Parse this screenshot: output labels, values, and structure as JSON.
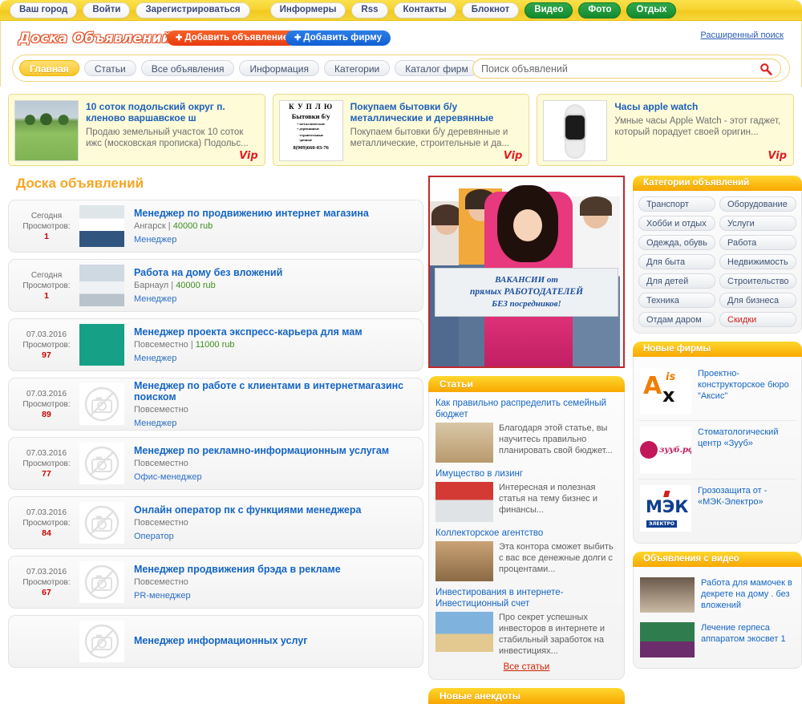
{
  "topbar": {
    "items": [
      {
        "label": "Ваш город",
        "style": "light"
      },
      {
        "label": "Войти",
        "style": "light"
      },
      {
        "label": "Зарегистрироваться",
        "style": "light"
      },
      {
        "label": "Информеры",
        "style": "light"
      },
      {
        "label": "Rss",
        "style": "light"
      },
      {
        "label": "Контакты",
        "style": "light"
      },
      {
        "label": "Блокнот",
        "style": "light"
      },
      {
        "label": "Видео",
        "style": "green"
      },
      {
        "label": "Фото",
        "style": "green"
      },
      {
        "label": "Отдых",
        "style": "green"
      }
    ]
  },
  "header": {
    "logo": "Доска Объявлений",
    "add_ad_button": "Добавить объявление",
    "add_firm_button": "Добавить фирму",
    "advanced_search": "Расширенный поиск",
    "plus": "✚",
    "search_placeholder": "Поиск объявлений",
    "search_value": "",
    "search_icon": "search-icon"
  },
  "tabs": [
    {
      "label": "Главная",
      "active": true
    },
    {
      "label": "Статьи",
      "active": false
    },
    {
      "label": "Все объявления",
      "active": false
    },
    {
      "label": "Информация",
      "active": false
    },
    {
      "label": "Категории",
      "active": false
    },
    {
      "label": "Каталог фирм",
      "active": false
    }
  ],
  "vip_cards": [
    {
      "title": "10 соток подольский округ п. кленово варшавское ш",
      "desc": "Продаю земельный участок 10 соток ижс (московская прописка) Подольс...",
      "badge": "Vip",
      "art": "land"
    },
    {
      "title": "Покупаем бытовки б/у металлические и деревянные",
      "desc": "Покупаем бытовки б/у деревянные и металлические, строительные и да...",
      "badge": "Vip",
      "art": "kuplyu",
      "art_text": {
        "line1": "К У П Л Ю",
        "line2": "Бытовки б/у",
        "line3": "• металлические\n• деревянные",
        "line4": "-строительные\n-дачные",
        "phone": "8(909)660-03-76"
      }
    },
    {
      "title": "Часы apple watch",
      "desc": "Умные часы Apple Watch - этот гаджет, который порадует своей оригин...",
      "badge": "Vip",
      "art": "watch"
    }
  ],
  "board": {
    "title": "Доска объявлений",
    "views_label": "Просмотров:",
    "listings": [
      {
        "date": "Сегодня",
        "views": "1",
        "title": "Менеджер по продвижению интернет магазина",
        "city": "Ангарск",
        "price": "40000 rub",
        "category": "Менеджер",
        "thumb": "photo-a"
      },
      {
        "date": "Сегодня",
        "views": "1",
        "title": "Работа на дому без вложений",
        "city": "Барнаул",
        "price": "40000 rub",
        "category": "Менеджер",
        "thumb": "photo-b"
      },
      {
        "date": "07.03.2016",
        "views": "97",
        "title": "Менеджер проекта экспресс-карьера для мам",
        "city": "Повсеместно",
        "price": "11000 rub",
        "category": "Менеджер",
        "thumb": "photo-c"
      },
      {
        "date": "07.03.2016",
        "views": "89",
        "title": "Менеджер по работе с клиентами в интернетмагазинс поиском",
        "city": "Повсеместно",
        "price": "",
        "category": "Менеджер",
        "thumb": "nophoto"
      },
      {
        "date": "07.03.2016",
        "views": "77",
        "title": "Менеджер по рекламно-информационным услугам",
        "city": "Повсеместно",
        "price": "",
        "category": "Офис-менеджер",
        "thumb": "nophoto"
      },
      {
        "date": "07.03.2016",
        "views": "84",
        "title": "Онлайн оператор пк с функциями менеджера",
        "city": "Повсеместно",
        "price": "",
        "category": "Оператор",
        "thumb": "nophoto"
      },
      {
        "date": "07.03.2016",
        "views": "67",
        "title": "Менеджер продвижения брэда в рекламе",
        "city": "Повсеместно",
        "price": "",
        "category": "PR-менеджер",
        "thumb": "nophoto"
      },
      {
        "date": "",
        "views": "",
        "title": "Менеджер информационных услуг",
        "city": "",
        "price": "",
        "category": "",
        "thumb": "nophoto"
      }
    ]
  },
  "banner": {
    "line1": "ВАКАНСИИ от",
    "line2": "прямых РАБОТОДАТЕЛЕЙ",
    "line3": "БЕЗ посредников!"
  },
  "articles": {
    "heading": "Статьи",
    "all_link": "Все статьи",
    "items": [
      {
        "title": "Как правильно распределить семейный бюджет",
        "desc": "Благодаря этой статье, вы научитесь правильно планировать свой бюджет...",
        "thumb": "th1"
      },
      {
        "title": "Имущество в лизинг",
        "desc": "Интересная и полезная статья на тему бизнес и финансы...",
        "thumb": "th2"
      },
      {
        "title": "Коллекторское агентство",
        "desc": "Эта контора сможет выбить с вас все денежные долги с процентами...",
        "thumb": "th3"
      },
      {
        "title": "Инвестирования в интернете- Инвестиционный счет",
        "desc": "Про секрет успешных инвесторов в интернете и стабильный заработок на инвестициях...",
        "thumb": "th4"
      }
    ]
  },
  "jokes": {
    "heading": "Новые анекдоты"
  },
  "categories": {
    "heading": "Категории объявлений",
    "items": [
      {
        "label": "Транспорт",
        "sale": false
      },
      {
        "label": "Оборудование",
        "sale": false
      },
      {
        "label": "Хобби и отдых",
        "sale": false
      },
      {
        "label": "Услуги",
        "sale": false
      },
      {
        "label": "Одежда, обувь",
        "sale": false
      },
      {
        "label": "Работа",
        "sale": false
      },
      {
        "label": "Для быта",
        "sale": false
      },
      {
        "label": "Недвижимость",
        "sale": false
      },
      {
        "label": "Для детей",
        "sale": false
      },
      {
        "label": "Строительство",
        "sale": false
      },
      {
        "label": "Техника",
        "sale": false
      },
      {
        "label": "Для бизнеса",
        "sale": false
      },
      {
        "label": "Отдам даром",
        "sale": false
      },
      {
        "label": "Скидки",
        "sale": true
      }
    ]
  },
  "firms": {
    "heading": "Новые фирмы",
    "items": [
      {
        "name": "Проектно-конструкторское бюро \"Аксис\"",
        "logo": "axis",
        "logo_text": {
          "a": "A",
          "is": "is",
          "x": "x"
        }
      },
      {
        "name": "Стоматологический центр «Зууб»",
        "logo": "zuub",
        "logo_text": "зууб.рф"
      },
      {
        "name": "Грозозащита от - «МЭК-Электро»",
        "logo": "mzk",
        "logo_text": {
          "m": "МЭК",
          "e": "ЭЛЕКТРО"
        }
      }
    ]
  },
  "video_ads": {
    "heading": "Объявления с видео",
    "items": [
      {
        "name": "Работа для мамочек в декрете на дому . без вложений",
        "thumb": "vt1"
      },
      {
        "name": "Лечение герпеса аппаратом экосвет 1",
        "thumb": "vt2"
      }
    ]
  }
}
